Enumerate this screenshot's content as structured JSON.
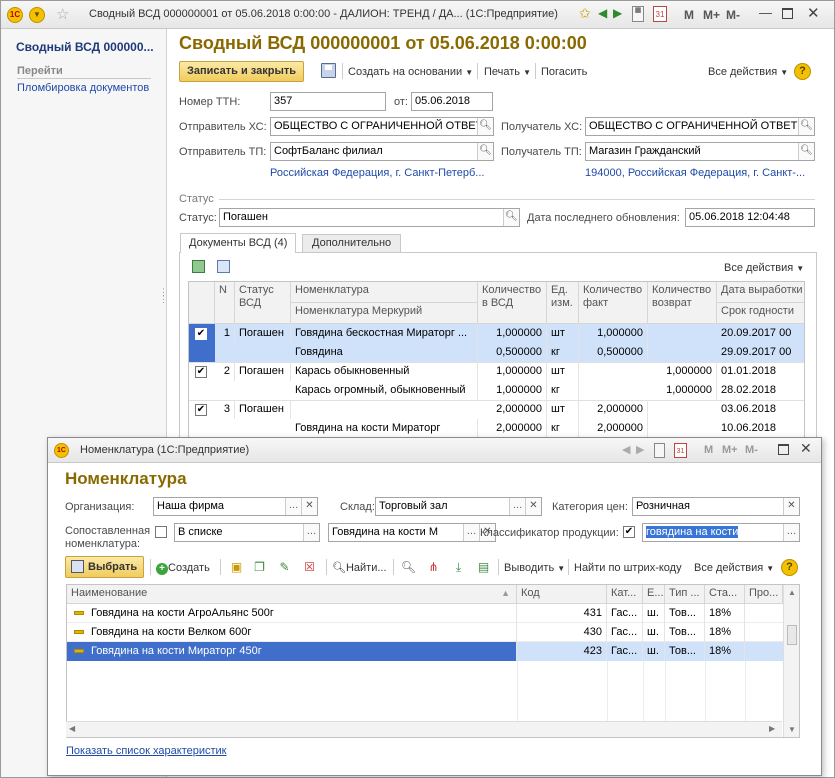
{
  "main": {
    "title": "Сводный ВСД 000000001 от 05.06.2018 0:00:00 - ДАЛИОН: ТРЕНД / ДА...  (1С:Предприятие)",
    "sidebar": {
      "title": "Сводный ВСД 000000...",
      "nav_title": "Перейти",
      "items": [
        "Пломбировка документов"
      ]
    },
    "doc_title": "Сводный ВСД 000000001 от 05.06.2018 0:00:00",
    "toolbar": {
      "save_close": "Записать и закрыть",
      "create_based": "Создать на основании",
      "print": "Печать",
      "pay": "Погасить",
      "all_actions": "Все действия",
      "help": "?"
    },
    "form": {
      "ttn_label": "Номер ТТН:",
      "ttn_value": "357",
      "date_label": "от:",
      "date_value": "05.06.2018",
      "sender_hs_label": "Отправитель ХС:",
      "sender_hs_value": "ОБЩЕСТВО С ОГРАНИЧЕННОЙ ОТВЕТ",
      "receiver_hs_label": "Получатель ХС:",
      "receiver_hs_value": "ОБЩЕСТВО С ОГРАНИЧЕННОЙ ОТВЕТС",
      "sender_tp_label": "Отправитель ТП:",
      "sender_tp_value": "СофтБаланс филиал",
      "receiver_tp_label": "Получатель ТП:",
      "receiver_tp_value": "Магазин Гражданский",
      "sender_addr": "Российская Федерация, г. Санкт-Петерб...",
      "receiver_addr": "194000, Российская Федерация, г. Санкт-...",
      "status_group": "Статус",
      "status_label": "Статус:",
      "status_value": "Погашен",
      "updated_label": "Дата последнего обновления:",
      "updated_value": "05.06.2018 12:04:48"
    },
    "tabs": [
      "Документы ВСД (4)",
      "Дополнительно"
    ],
    "grid": {
      "all_actions": "Все действия",
      "headers": {
        "n": "N",
        "status": "Статус ВСД",
        "nom": "Номенклатура",
        "nom_merc": "Номенклатура Меркурий",
        "qty_vsd": "Количество в ВСД",
        "unit": "Ед. изм.",
        "qty_fact": "Количество факт",
        "qty_ret": "Количество возврат",
        "date_prod": "Дата выработки",
        "exp": "Срок годности"
      },
      "rows": [
        {
          "n": "1",
          "status": "Погашен",
          "nom": "Говядина бескостная Мираторг ...",
          "qty": "1,000000",
          "unit": "шт",
          "fact": "1,000000",
          "ret": "",
          "date": "20.09.2017 00"
        },
        {
          "n": "",
          "status": "",
          "nom": "Говядина",
          "qty": "0,500000",
          "unit": "кг",
          "fact": "0,500000",
          "ret": "",
          "date": "29.09.2017 00"
        },
        {
          "n": "2",
          "status": "Погашен",
          "nom": "Карась обыкновенный",
          "qty": "1,000000",
          "unit": "шт",
          "fact": "",
          "ret": "1,000000",
          "date": "01.01.2018"
        },
        {
          "n": "",
          "status": "",
          "nom": "Карась огромный, обыкновенный",
          "qty": "1,000000",
          "unit": "кг",
          "fact": "",
          "ret": "1,000000",
          "date": "28.02.2018"
        },
        {
          "n": "3",
          "status": "Погашен",
          "nom": "",
          "qty": "2,000000",
          "unit": "шт",
          "fact": "2,000000",
          "ret": "",
          "date": "03.06.2018"
        },
        {
          "n": "",
          "status": "",
          "nom": "Говядина на кости Мираторг",
          "qty": "2,000000",
          "unit": "кг",
          "fact": "2,000000",
          "ret": "",
          "date": "10.06.2018"
        }
      ]
    }
  },
  "dialog": {
    "title": "Номенклатура  (1С:Предприятие)",
    "heading": "Номенклатура",
    "filters": {
      "org_label": "Организация:",
      "org_value": "Наша фирма",
      "warehouse_label": "Склад:",
      "warehouse_value": "Торговый зал",
      "price_label": "Категория цен:",
      "price_value": "Розничная",
      "matched_label": "Сопоставленная номенклатура:",
      "matched_value": "В списке",
      "matched_nom_value": "Говядина на кости М",
      "classifier_label": "Классификатор продукции:",
      "classifier_value": "говядина на кости"
    },
    "toolbar": {
      "select": "Выбрать",
      "create": "Создать",
      "find": "Найти...",
      "output": "Выводить",
      "barcode": "Найти по штрих-коду",
      "all_actions": "Все действия",
      "help": "?"
    },
    "columns": [
      "Наименование",
      "Код",
      "Кат...",
      "Е...",
      "Тип ...",
      "Ста...",
      "Про..."
    ],
    "rows": [
      {
        "name": "Говядина на кости АгроАльянс 500г",
        "code": "431",
        "cat": "Гас...",
        "e": "ш.",
        "type": "Тов...",
        "rate": "18%"
      },
      {
        "name": "Говядина на кости Велком 600г",
        "code": "430",
        "cat": "Гас...",
        "e": "ш.",
        "type": "Тов...",
        "rate": "18%"
      },
      {
        "name": "Говядина на кости Мираторг 450г",
        "code": "423",
        "cat": "Гас...",
        "e": "ш.",
        "type": "Тов...",
        "rate": "18%"
      }
    ],
    "footer_link": "Показать список характеристик"
  },
  "titlebar": {
    "m": "M",
    "mplus": "M+",
    "mminus": "M-"
  }
}
